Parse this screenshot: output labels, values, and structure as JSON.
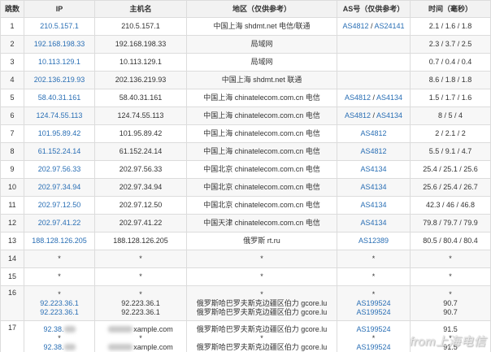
{
  "headers": {
    "hop": "跳数",
    "ip": "IP",
    "host": "主机名",
    "region": "地区（仅供参考）",
    "as": "AS号（仅供参考）",
    "time": "时间（毫秒）"
  },
  "rows": [
    {
      "hop": "1",
      "ip": "210.5.157.1",
      "host": "210.5.157.1",
      "region": "中国上海 shdmt.net 电信/联通",
      "as": [
        "AS4812",
        "AS24141"
      ],
      "time": "2.1 / 1.6 / 1.8"
    },
    {
      "hop": "2",
      "ip": "192.168.198.33",
      "host": "192.168.198.33",
      "region": "局域网",
      "as": [],
      "time": "2.3 / 3.7 / 2.5"
    },
    {
      "hop": "3",
      "ip": "10.113.129.1",
      "host": "10.113.129.1",
      "region": "局域网",
      "as": [],
      "time": "0.7 / 0.4 / 0.4"
    },
    {
      "hop": "4",
      "ip": "202.136.219.93",
      "host": "202.136.219.93",
      "region": "中国上海 shdmt.net 联通",
      "as": [],
      "time": "8.6 / 1.8 / 1.8"
    },
    {
      "hop": "5",
      "ip": "58.40.31.161",
      "host": "58.40.31.161",
      "region": "中国上海 chinatelecom.com.cn 电信",
      "as": [
        "AS4812",
        "AS4134"
      ],
      "time": "1.5 / 1.7 / 1.6"
    },
    {
      "hop": "6",
      "ip": "124.74.55.113",
      "host": "124.74.55.113",
      "region": "中国上海 chinatelecom.com.cn 电信",
      "as": [
        "AS4812",
        "AS4134"
      ],
      "time": "8 / 5 / 4"
    },
    {
      "hop": "7",
      "ip": "101.95.89.42",
      "host": "101.95.89.42",
      "region": "中国上海 chinatelecom.com.cn 电信",
      "as": [
        "AS4812"
      ],
      "time": "2 / 2.1 / 2"
    },
    {
      "hop": "8",
      "ip": "61.152.24.14",
      "host": "61.152.24.14",
      "region": "中国上海 chinatelecom.com.cn 电信",
      "as": [
        "AS4812"
      ],
      "time": "5.5 / 9.1 / 4.7"
    },
    {
      "hop": "9",
      "ip": "202.97.56.33",
      "host": "202.97.56.33",
      "region": "中国北京 chinatelecom.com.cn 电信",
      "as": [
        "AS4134"
      ],
      "time": "25.4 / 25.1 / 25.6"
    },
    {
      "hop": "10",
      "ip": "202.97.34.94",
      "host": "202.97.34.94",
      "region": "中国北京 chinatelecom.com.cn 电信",
      "as": [
        "AS4134"
      ],
      "time": "25.6 / 25.4 / 26.7"
    },
    {
      "hop": "11",
      "ip": "202.97.12.50",
      "host": "202.97.12.50",
      "region": "中国北京 chinatelecom.com.cn 电信",
      "as": [
        "AS4134"
      ],
      "time": "42.3 / 46 / 46.8"
    },
    {
      "hop": "12",
      "ip": "202.97.41.22",
      "host": "202.97.41.22",
      "region": "中国天津 chinatelecom.com.cn 电信",
      "as": [
        "AS4134"
      ],
      "time": "79.8 / 79.7 / 79.9"
    },
    {
      "hop": "13",
      "ip": "188.128.126.205",
      "host": "188.128.126.205",
      "region": "俄罗斯 rt.ru",
      "as": [
        "AS12389"
      ],
      "time": "80.5 / 80.4 / 80.4"
    },
    {
      "hop": "14",
      "ip": "*",
      "host": "*",
      "region": "*",
      "as": [
        "*"
      ],
      "time": "*"
    },
    {
      "hop": "15",
      "ip": "*",
      "host": "*",
      "region": "*",
      "as": [
        "*"
      ],
      "time": "*"
    }
  ],
  "tall_rows": [
    {
      "hop": "16",
      "lines": [
        {
          "ip": "*",
          "host": "*",
          "region": "*",
          "as": "*",
          "time": "*"
        },
        {
          "ip": "92.223.36.1",
          "host": "92.223.36.1",
          "region": "俄罗斯哈巴罗夫斯克边疆区伯力 gcore.lu",
          "as": "AS199524",
          "time": "90.7"
        },
        {
          "ip": "92.223.36.1",
          "host": "92.223.36.1",
          "region": "俄罗斯哈巴罗夫斯克边疆区伯力 gcore.lu",
          "as": "AS199524",
          "time": "90.7"
        }
      ]
    },
    {
      "hop": "17",
      "lines": [
        {
          "ip": "92.38.",
          "host": "xample.com",
          "region": "俄罗斯哈巴罗夫斯克边疆区伯力 gcore.lu",
          "as": "AS199524",
          "time": "91.5"
        },
        {
          "ip": "*",
          "host": "*",
          "region": "*",
          "as": "*",
          "time": "*"
        },
        {
          "ip": "92.38.",
          "host": "xample.com",
          "region": "俄罗斯哈巴罗夫斯克边疆区伯力 gcore.lu",
          "as": "AS199524",
          "time": "91.5"
        }
      ]
    }
  ],
  "separator": "/",
  "watermark": "from上海电信"
}
